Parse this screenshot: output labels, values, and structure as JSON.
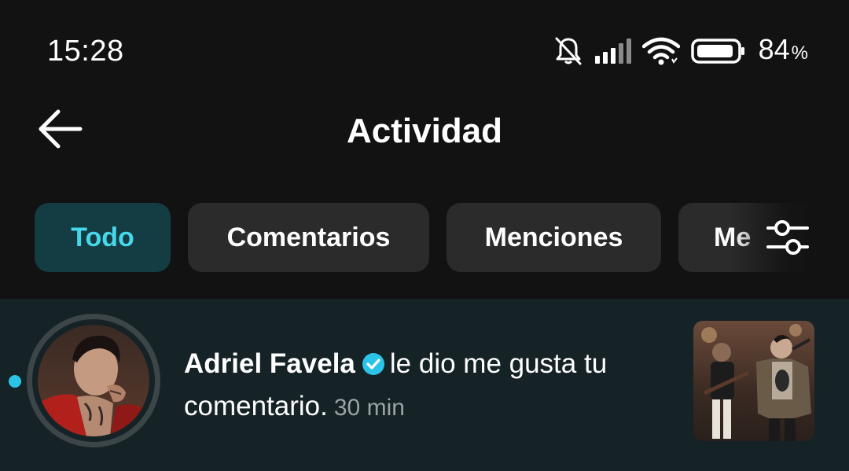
{
  "status_bar": {
    "time": "15:28",
    "battery_value": "84",
    "battery_unit": "%",
    "icons": [
      "bell-muted-icon",
      "signal-icon",
      "wifi-icon",
      "battery-icon"
    ]
  },
  "header": {
    "title": "Actividad",
    "back_icon": "arrow-left-icon"
  },
  "filters": {
    "chips": [
      {
        "label": "Todo",
        "active": true
      },
      {
        "label": "Comentarios",
        "active": false
      },
      {
        "label": "Menciones",
        "active": false
      },
      {
        "label": "Me",
        "active": false
      }
    ],
    "settings_icon": "sliders-icon"
  },
  "notifications": [
    {
      "user": "Adriel Favela",
      "verified": true,
      "message": "le dio me gusta tu comentario.",
      "time": "30 min",
      "unread": true
    }
  ],
  "colors": {
    "background": "#121212",
    "chip_bg": "#2b2b2b",
    "chip_active_bg": "#143c43",
    "chip_active_text": "#46d8ea",
    "row_bg": "#152226",
    "unread_dot": "#2bc4e8",
    "verified": "#2bc4e8",
    "muted_text": "#9aa3a6"
  }
}
